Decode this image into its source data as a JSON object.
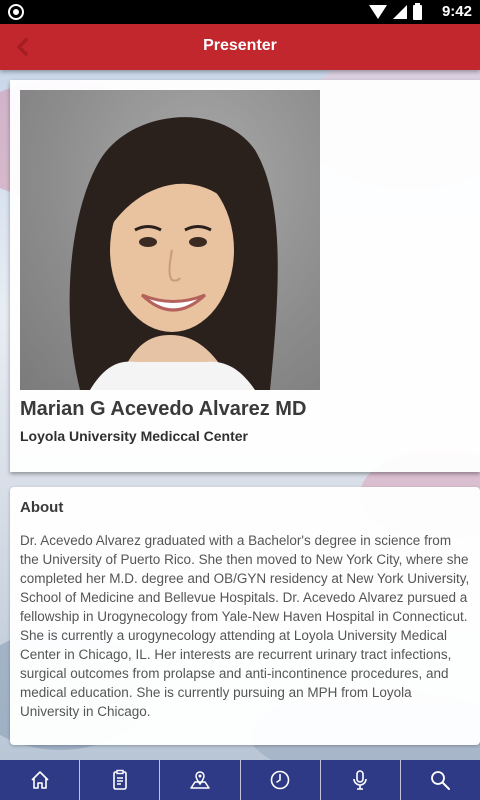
{
  "status_bar": {
    "time": "9:42"
  },
  "header": {
    "title": "Presenter",
    "accent_color": "#c1272d"
  },
  "presenter": {
    "name": "Marian G Acevedo Alvarez MD",
    "organization": "Loyola University Medicсal Center"
  },
  "about": {
    "title": "About",
    "text": "Dr. Acevedo Alvarez graduated with a Bachelor's degree in science from the University of Puerto Rico. She then moved to New York City, where she completed her M.D. degree and OB/GYN residency at New York University, School of Medicine and Bellevue Hospitals. Dr. Acevedo Alvarez pursued a fellowship in Urogynecology from Yale-New Haven Hospital in Connecticut. She is currently a urogynecology attending at Loyola University Medical Center in Chicago, IL. Her interests are recurrent urinary tract infections, surgical outcomes from prolapse and anti-incontinence procedures, and medical education. She is currently pursuing an MPH from Loyola University in Chicago."
  },
  "bottom_nav": {
    "color": "#2f3a86",
    "items": [
      {
        "icon": "home-icon"
      },
      {
        "icon": "schedule-icon"
      },
      {
        "icon": "map-icon"
      },
      {
        "icon": "clock-icon"
      },
      {
        "icon": "microphone-icon"
      },
      {
        "icon": "search-icon"
      }
    ]
  }
}
